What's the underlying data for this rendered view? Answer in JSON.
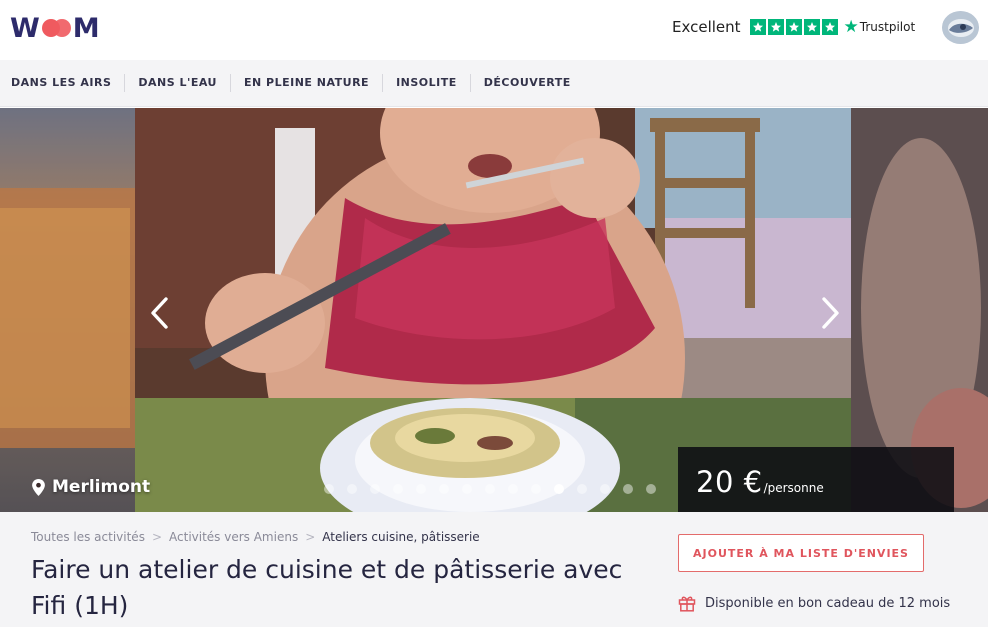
{
  "header": {
    "logo_text": "WOM",
    "trust_label": "Excellent",
    "trust_brand": "Trustpilot",
    "trust_stars": 5
  },
  "nav": {
    "items": [
      {
        "label": "DANS LES AIRS"
      },
      {
        "label": "DANS L'EAU"
      },
      {
        "label": "EN PLEINE NATURE"
      },
      {
        "label": "INSOLITE"
      },
      {
        "label": "DÉCOUVERTE"
      }
    ]
  },
  "carousel": {
    "location": "Merlimont",
    "price_amount": "20 €",
    "price_unit": "/personne",
    "slide_count": 15,
    "active_slide_index": 10
  },
  "info": {
    "breadcrumb": [
      {
        "label": "Toutes les activités"
      },
      {
        "label": "Activités vers Amiens"
      },
      {
        "label": "Ateliers cuisine, pâtisserie"
      }
    ],
    "breadcrumb_separator": ">",
    "title": "Faire un atelier de cuisine et de pâtisserie avec Fifi (1H)",
    "wishlist_button": "AJOUTER À MA LISTE D'ENVIES",
    "gift_text": "Disponible en bon cadeau de 12 mois"
  },
  "colors": {
    "brand_navy": "#2d2b6b",
    "brand_coral": "#ef5a5f",
    "trustpilot_green": "#00b67a",
    "accent_red": "#e0555d"
  },
  "icons": {
    "logo_heart": "heart-icon",
    "trust_star": "star-icon",
    "location": "map-pin-icon",
    "prev": "chevron-left-icon",
    "next": "chevron-right-icon",
    "gift": "gift-icon"
  }
}
